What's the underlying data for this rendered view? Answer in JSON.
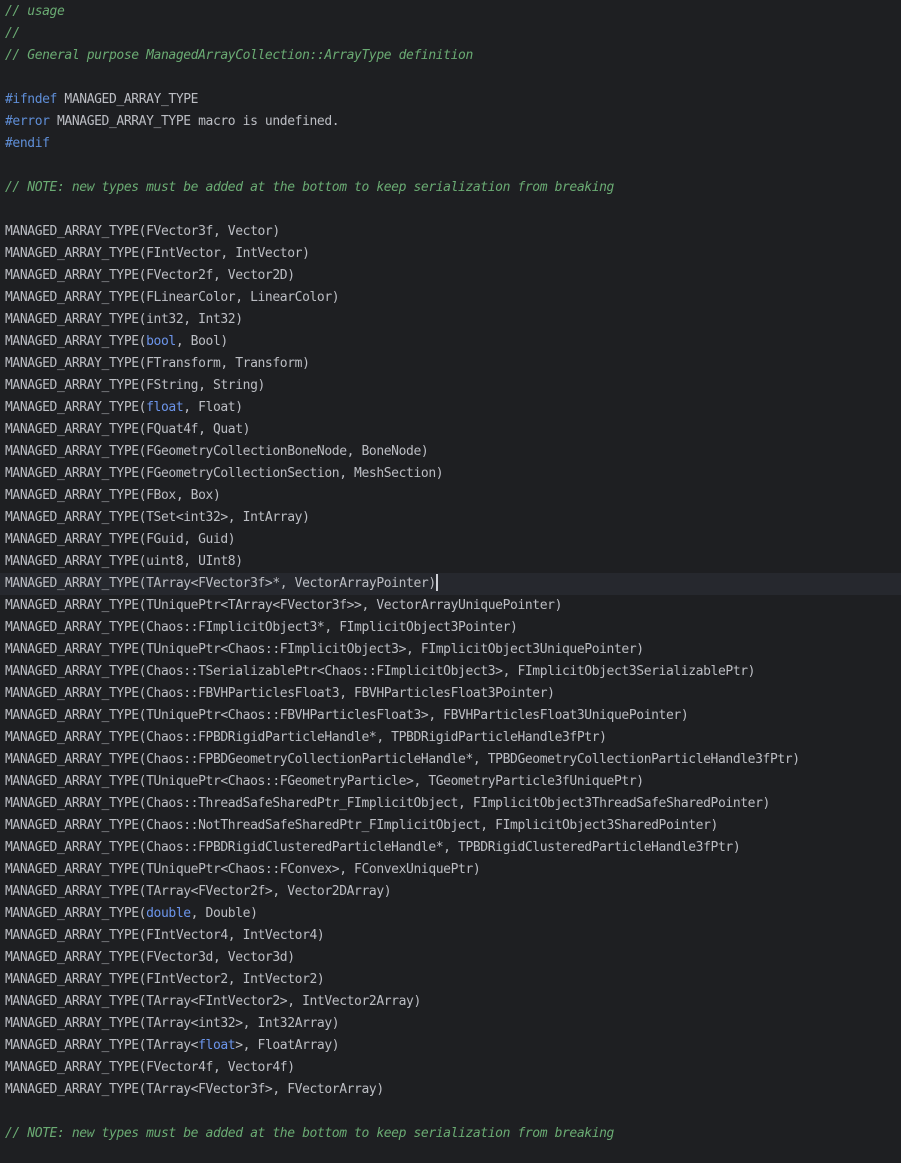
{
  "editor": {
    "caret_line": 26,
    "lines": [
      [
        {
          "t": "// usage",
          "c": "comment"
        }
      ],
      [
        {
          "t": "//",
          "c": "comment"
        }
      ],
      [
        {
          "t": "// General purpose ManagedArrayCollection::ArrayType definition",
          "c": "comment"
        }
      ],
      [],
      [
        {
          "t": "#ifndef",
          "c": "directive"
        },
        {
          "t": " MANAGED_ARRAY_TYPE",
          "c": "text"
        }
      ],
      [
        {
          "t": "#error",
          "c": "directive"
        },
        {
          "t": " MANAGED_ARRAY_TYPE macro is undefined.",
          "c": "text"
        }
      ],
      [
        {
          "t": "#endif",
          "c": "directive"
        }
      ],
      [],
      [
        {
          "t": "// NOTE: new types must be added at the bottom to keep serialization from breaking",
          "c": "comment"
        }
      ],
      [],
      [
        {
          "t": "MANAGED_ARRAY_TYPE(FVector3f, Vector)",
          "c": "text"
        }
      ],
      [
        {
          "t": "MANAGED_ARRAY_TYPE(FIntVector, IntVector)",
          "c": "text"
        }
      ],
      [
        {
          "t": "MANAGED_ARRAY_TYPE(FVector2f, Vector2D)",
          "c": "text"
        }
      ],
      [
        {
          "t": "MANAGED_ARRAY_TYPE(FLinearColor, LinearColor)",
          "c": "text"
        }
      ],
      [
        {
          "t": "MANAGED_ARRAY_TYPE(int32, Int32)",
          "c": "text"
        }
      ],
      [
        {
          "t": "MANAGED_ARRAY_TYPE(",
          "c": "text"
        },
        {
          "t": "bool",
          "c": "keyword"
        },
        {
          "t": ", Bool)",
          "c": "text"
        }
      ],
      [
        {
          "t": "MANAGED_ARRAY_TYPE(FTransform, Transform)",
          "c": "text"
        }
      ],
      [
        {
          "t": "MANAGED_ARRAY_TYPE(FString, String)",
          "c": "text"
        }
      ],
      [
        {
          "t": "MANAGED_ARRAY_TYPE(",
          "c": "text"
        },
        {
          "t": "float",
          "c": "keyword"
        },
        {
          "t": ", Float)",
          "c": "text"
        }
      ],
      [
        {
          "t": "MANAGED_ARRAY_TYPE(FQuat4f, Quat)",
          "c": "text"
        }
      ],
      [
        {
          "t": "MANAGED_ARRAY_TYPE(FGeometryCollectionBoneNode, BoneNode)",
          "c": "text"
        }
      ],
      [
        {
          "t": "MANAGED_ARRAY_TYPE(FGeometryCollectionSection, MeshSection)",
          "c": "text"
        }
      ],
      [
        {
          "t": "MANAGED_ARRAY_TYPE(FBox, Box)",
          "c": "text"
        }
      ],
      [
        {
          "t": "MANAGED_ARRAY_TYPE(TSet<int32>, IntArray)",
          "c": "text"
        }
      ],
      [
        {
          "t": "MANAGED_ARRAY_TYPE(FGuid, Guid)",
          "c": "text"
        }
      ],
      [
        {
          "t": "MANAGED_ARRAY_TYPE(uint8, UInt8)",
          "c": "text"
        }
      ],
      [
        {
          "t": "MANAGED_ARRAY_TYPE(TArray<FVector3f>*, VectorArrayPointer)",
          "c": "text"
        }
      ],
      [
        {
          "t": "MANAGED_ARRAY_TYPE(TUniquePtr<TArray<FVector3f>>, VectorArrayUniquePointer)",
          "c": "text"
        }
      ],
      [
        {
          "t": "MANAGED_ARRAY_TYPE(Chaos::FImplicitObject3*, FImplicitObject3Pointer)",
          "c": "text"
        }
      ],
      [
        {
          "t": "MANAGED_ARRAY_TYPE(TUniquePtr<Chaos::FImplicitObject3>, FImplicitObject3UniquePointer)",
          "c": "text"
        }
      ],
      [
        {
          "t": "MANAGED_ARRAY_TYPE(Chaos::TSerializablePtr<Chaos::FImplicitObject3>, FImplicitObject3SerializablePtr)",
          "c": "text"
        }
      ],
      [
        {
          "t": "MANAGED_ARRAY_TYPE(Chaos::FBVHParticlesFloat3, FBVHParticlesFloat3Pointer)",
          "c": "text"
        }
      ],
      [
        {
          "t": "MANAGED_ARRAY_TYPE(TUniquePtr<Chaos::FBVHParticlesFloat3>, FBVHParticlesFloat3UniquePointer)",
          "c": "text"
        }
      ],
      [
        {
          "t": "MANAGED_ARRAY_TYPE(Chaos::FPBDRigidParticleHandle*, TPBDRigidParticleHandle3fPtr)",
          "c": "text"
        }
      ],
      [
        {
          "t": "MANAGED_ARRAY_TYPE(Chaos::FPBDGeometryCollectionParticleHandle*, TPBDGeometryCollectionParticleHandle3fPtr)",
          "c": "text"
        }
      ],
      [
        {
          "t": "MANAGED_ARRAY_TYPE(TUniquePtr<Chaos::FGeometryParticle>, TGeometryParticle3fUniquePtr)",
          "c": "text"
        }
      ],
      [
        {
          "t": "MANAGED_ARRAY_TYPE(Chaos::ThreadSafeSharedPtr_FImplicitObject, FImplicitObject3ThreadSafeSharedPointer)",
          "c": "text"
        }
      ],
      [
        {
          "t": "MANAGED_ARRAY_TYPE(Chaos::NotThreadSafeSharedPtr_FImplicitObject, FImplicitObject3SharedPointer)",
          "c": "text"
        }
      ],
      [
        {
          "t": "MANAGED_ARRAY_TYPE(Chaos::FPBDRigidClusteredParticleHandle*, TPBDRigidClusteredParticleHandle3fPtr)",
          "c": "text"
        }
      ],
      [
        {
          "t": "MANAGED_ARRAY_TYPE(TUniquePtr<Chaos::FConvex>, FConvexUniquePtr)",
          "c": "text"
        }
      ],
      [
        {
          "t": "MANAGED_ARRAY_TYPE(TArray<FVector2f>, Vector2DArray)",
          "c": "text"
        }
      ],
      [
        {
          "t": "MANAGED_ARRAY_TYPE(",
          "c": "text"
        },
        {
          "t": "double",
          "c": "keyword"
        },
        {
          "t": ", Double)",
          "c": "text"
        }
      ],
      [
        {
          "t": "MANAGED_ARRAY_TYPE(FIntVector4, IntVector4)",
          "c": "text"
        }
      ],
      [
        {
          "t": "MANAGED_ARRAY_TYPE(FVector3d, Vector3d)",
          "c": "text"
        }
      ],
      [
        {
          "t": "MANAGED_ARRAY_TYPE(FIntVector2, IntVector2)",
          "c": "text"
        }
      ],
      [
        {
          "t": "MANAGED_ARRAY_TYPE(TArray<FIntVector2>, IntVector2Array)",
          "c": "text"
        }
      ],
      [
        {
          "t": "MANAGED_ARRAY_TYPE(TArray<int32>, Int32Array)",
          "c": "text"
        }
      ],
      [
        {
          "t": "MANAGED_ARRAY_TYPE(TArray<",
          "c": "text"
        },
        {
          "t": "float",
          "c": "keyword"
        },
        {
          "t": ">, FloatArray)",
          "c": "text"
        }
      ],
      [
        {
          "t": "MANAGED_ARRAY_TYPE(FVector4f, Vector4f)",
          "c": "text"
        }
      ],
      [
        {
          "t": "MANAGED_ARRAY_TYPE(TArray<FVector3f>, FVectorArray)",
          "c": "text"
        }
      ],
      [],
      [
        {
          "t": "// NOTE: new types must be added at the bottom to keep serialization from breaking",
          "c": "comment"
        }
      ]
    ]
  },
  "colors": {
    "background": "#1e1f22",
    "text": "#bcbec4",
    "comment": "#6aab73",
    "directive": "#5f8ed7",
    "keyword": "#6c95eb",
    "current_line": "#26282e"
  }
}
